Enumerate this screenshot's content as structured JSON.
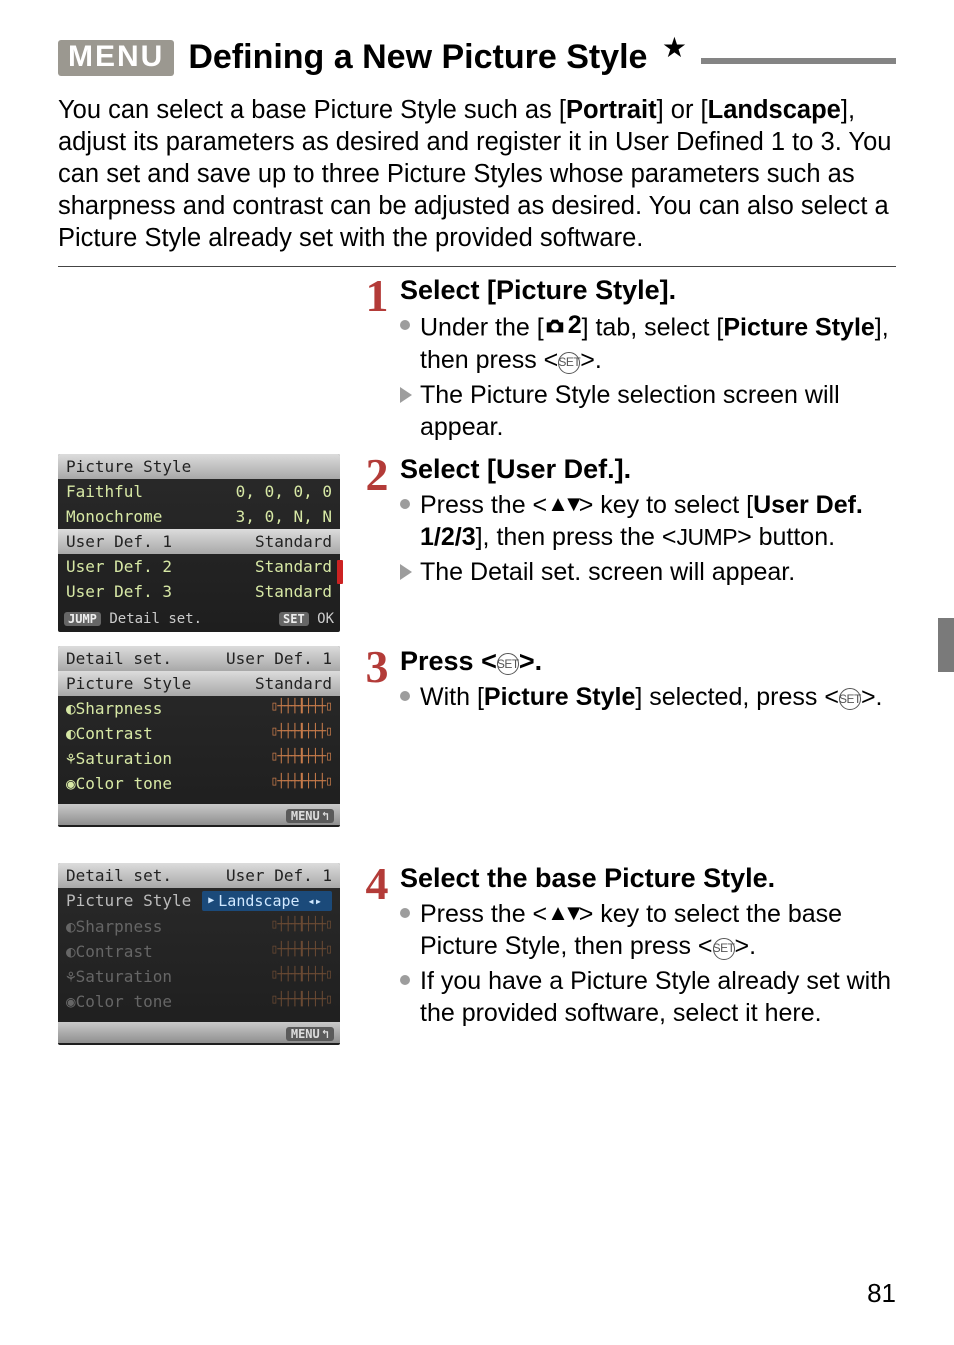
{
  "heading": {
    "menu_badge": "MENU",
    "title": "Defining a New Picture Style",
    "star": "★"
  },
  "intro": "You can select a base Picture Style such as [Portrait] or [Landscape], adjust its parameters as desired and register it in User Defined 1 to 3. You can set and save up to three Picture Styles whose parameters such as sharpness and contrast can be adjusted as desired. You can also select a Picture Style already set with the provided software.",
  "steps": {
    "s1": {
      "num": "1",
      "head": "Select [Picture Style].",
      "b1a": "Under the [",
      "b1_tabnum": "2",
      "b1b": "] tab, select [",
      "b1_bold": "Picture Style",
      "b1c": "], then press <",
      "b1d": ">.",
      "b2": "The Picture Style selection screen will appear."
    },
    "s2": {
      "num": "2",
      "head": "Select [User Def.].",
      "b1a": "Press the <",
      "b1b": "> key to select [",
      "b1_bold": "User Def. 1/2/3",
      "b1c": "], then press the <",
      "b1_jump": "JUMP",
      "b1d": "> button.",
      "b2": "The Detail set. screen will appear."
    },
    "s3": {
      "num": "3",
      "head_a": "Press <",
      "head_b": ">.",
      "b1a": "With [",
      "b1_bold": "Picture Style",
      "b1b": "] selected, press <",
      "b1c": ">."
    },
    "s4": {
      "num": "4",
      "head": "Select the base Picture Style.",
      "b1a": "Press the <",
      "b1b": "> key to select the base Picture Style, then press <",
      "b1c": ">.",
      "b2": "If you have a Picture Style already set with the provided software, select it here."
    }
  },
  "lcd1": {
    "title": "Picture Style",
    "rows": [
      {
        "k": "Faithful",
        "v": "0, 0, 0, 0"
      },
      {
        "k": "Monochrome",
        "v": "3, 0, N, N"
      },
      {
        "k": "User Def. 1",
        "v": "Standard"
      },
      {
        "k": "User Def. 2",
        "v": "Standard"
      },
      {
        "k": "User Def. 3",
        "v": "Standard"
      }
    ],
    "foot_left_pill": "JUMP",
    "foot_left": "Detail set.",
    "foot_right_pill": "SET",
    "foot_right": "OK"
  },
  "lcd2": {
    "title_l": "Detail set.",
    "title_r": "User Def. 1",
    "ps_k": "Picture Style",
    "ps_v": "Standard",
    "rows": [
      {
        "k": "Sharpness"
      },
      {
        "k": "Contrast"
      },
      {
        "k": "Saturation"
      },
      {
        "k": "Color tone"
      }
    ],
    "menu": "MENU"
  },
  "lcd3": {
    "title_l": "Detail set.",
    "title_r": "User Def. 1",
    "ps_k": "Picture Style",
    "ps_v": "Landscape",
    "rows": [
      {
        "k": "Sharpness"
      },
      {
        "k": "Contrast"
      },
      {
        "k": "Saturation"
      },
      {
        "k": "Color tone"
      }
    ],
    "menu": "MENU"
  },
  "slider_glyph": "▯┼┼┼╂┼┼┼▯",
  "pagenum": "81"
}
